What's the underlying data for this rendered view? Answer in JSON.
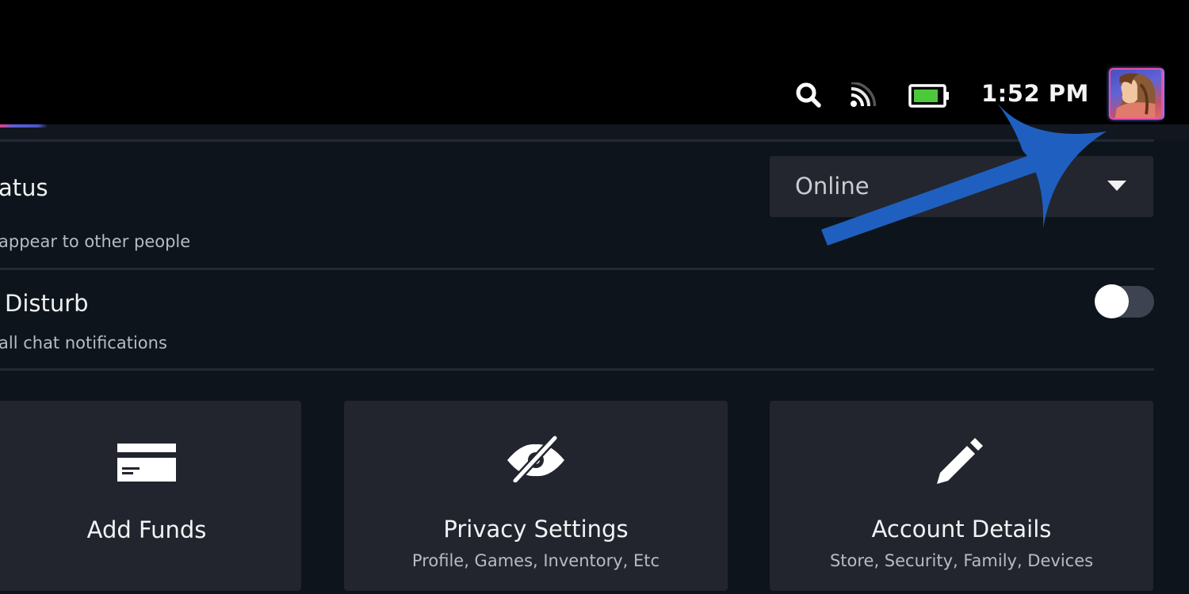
{
  "status_bar": {
    "icons": [
      "search-icon",
      "broadcast-icon",
      "battery-icon"
    ],
    "battery_color": "#4cc93a",
    "time": "1:52 PM"
  },
  "settings": {
    "status_row": {
      "title": "atus",
      "description": "appear to other people",
      "dropdown_value": "Online"
    },
    "dnd_row": {
      "title": "Disturb",
      "description": "all chat notifications",
      "toggle_on": false
    }
  },
  "cards": [
    {
      "icon": "credit-card-icon",
      "title": "Add Funds",
      "subtitle": ""
    },
    {
      "icon": "eye-slash-icon",
      "title": "Privacy Settings",
      "subtitle": "Profile, Games, Inventory, Etc"
    },
    {
      "icon": "pencil-icon",
      "title": "Account Details",
      "subtitle": "Store, Security, Family, Devices"
    }
  ],
  "annotation": {
    "color": "#1f5fbf",
    "points_to": "avatar"
  }
}
